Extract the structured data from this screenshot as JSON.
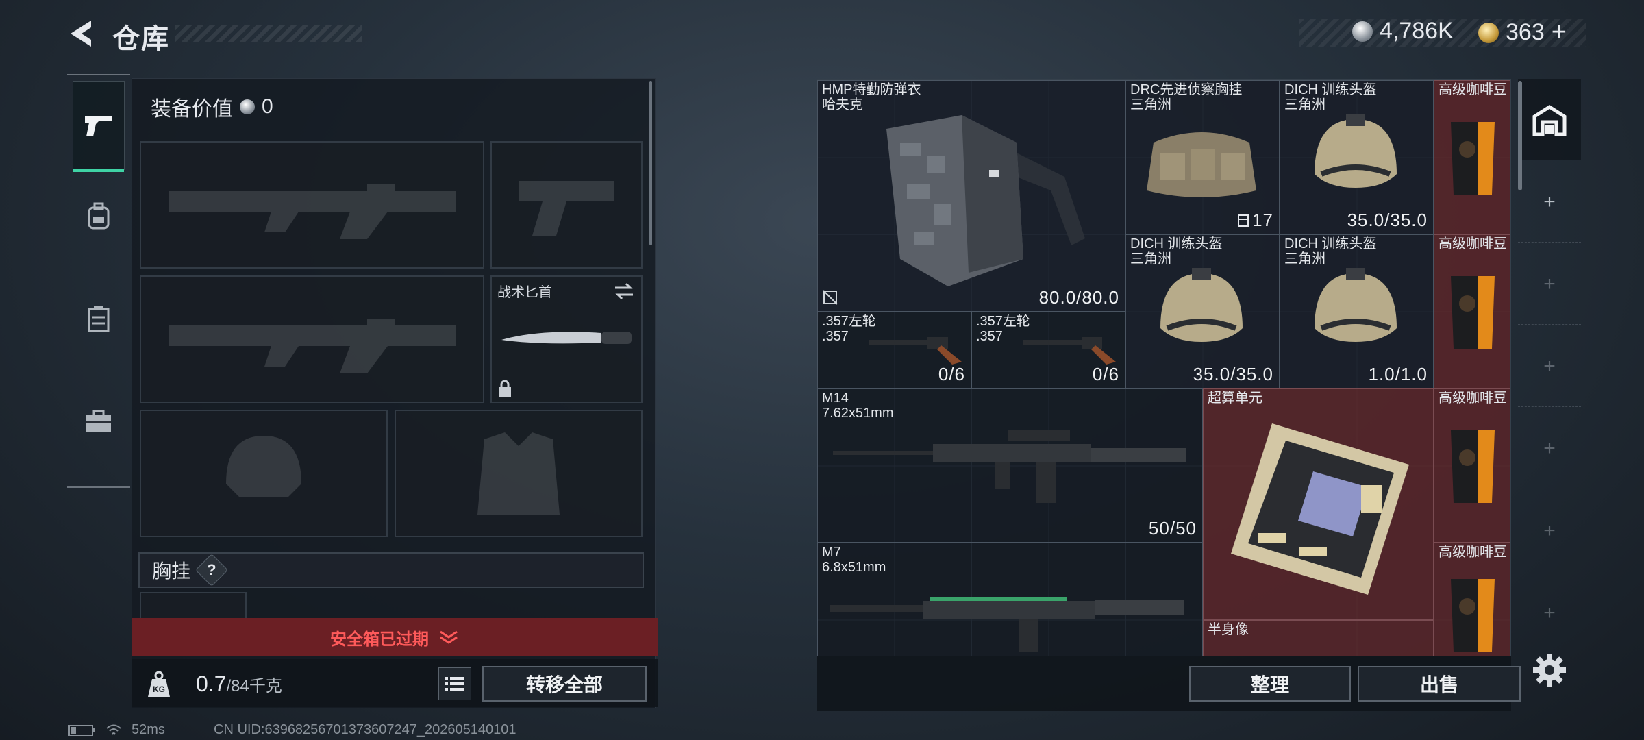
{
  "header": {
    "title": "仓库"
  },
  "currency": {
    "silver": "4,786K",
    "gold": "363"
  },
  "colors": {
    "accent": "#3fd3a5",
    "alert": "#ff5a5a",
    "rare_bg": "#5c282c"
  },
  "left_nav": {
    "items": [
      "pistol-icon",
      "backpack-icon",
      "chest-rig-icon",
      "briefcase-icon"
    ],
    "active": 0
  },
  "equipment": {
    "label": "装备价值",
    "value": "0"
  },
  "slots": {
    "knife_label": "战术匕首"
  },
  "chest_rig": {
    "label": "胸挂",
    "help": "?"
  },
  "safebox": {
    "status": "安全箱已过期"
  },
  "weight": {
    "current": "0.7",
    "max": "/84千克"
  },
  "actions": {
    "transfer_all": "转移全部",
    "sort": "整理",
    "sell": "出售"
  },
  "stash_items": {
    "vest": {
      "name": "HMP特勤防弹衣",
      "sub": "哈夫克",
      "value": "80.0/80.0"
    },
    "chest": {
      "name": "DRC先进侦察胸挂",
      "sub": "三角洲",
      "value": "17"
    },
    "helmet1": {
      "name": "DICH 训练头盔",
      "sub": "三角洲",
      "value": "35.0/35.0"
    },
    "coffee1": {
      "name": "高级咖啡豆"
    },
    "helmet2": {
      "name": "DICH 训练头盔",
      "sub": "三角洲",
      "value": "35.0/35.0"
    },
    "helmet3": {
      "name": "DICH 训练头盔",
      "sub": "三角洲",
      "value": "1.0/1.0"
    },
    "coffee2": {
      "name": "高级咖啡豆"
    },
    "revolver1": {
      "name": ".357左轮",
      "sub": ".357",
      "value": "0/6"
    },
    "revolver2": {
      "name": ".357左轮",
      "sub": ".357",
      "value": "0/6"
    },
    "m14": {
      "name": "M14",
      "sub": "7.62x51mm",
      "value": "50/50"
    },
    "compute": {
      "name": "超算单元"
    },
    "coffee3": {
      "name": "高级咖啡豆"
    },
    "m7": {
      "name": "M7",
      "sub": "6.8x51mm"
    },
    "coffee4": {
      "name": "高级咖啡豆"
    },
    "bust": {
      "name": "半身像"
    }
  },
  "status_bar": {
    "ping": "52ms",
    "uid": "CN UID:63968256701373607247_202605140101"
  }
}
